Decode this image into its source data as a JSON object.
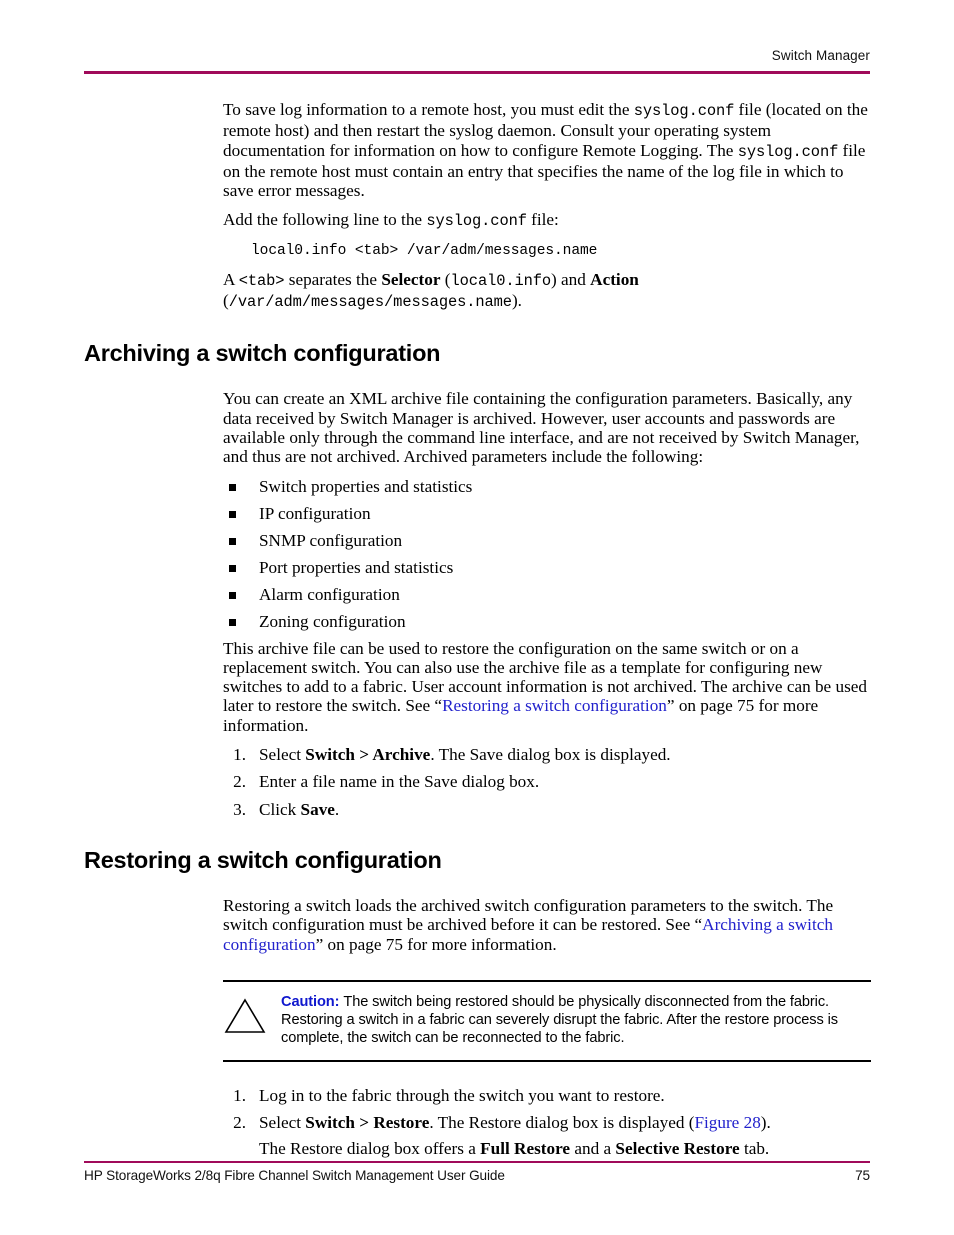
{
  "header": {
    "title": "Switch Manager",
    "rule_color": "#A00A5A"
  },
  "intro": {
    "para1_a": "To save log information to a remote host, you must edit the ",
    "para1_code1": "syslog.conf",
    "para1_b": " file (located on the remote host) and then restart the syslog daemon. Consult your operating system documentation for information on how to configure Remote Logging. The ",
    "para1_code2": "syslog.conf",
    "para1_c": " file on the remote host must contain an entry that specifies the name of the log file in which to save error messages.",
    "para2_a": "Add the following line to the ",
    "para2_code": "syslog.conf",
    "para2_b": " file:",
    "codeline": "local0.info <tab> /var/adm/messages.name",
    "para3_a": "A ",
    "para3_code1": "<tab>",
    "para3_b": " separates the ",
    "para3_bold1": "Selector",
    "para3_c": " (",
    "para3_code2": "local0.info",
    "para3_d": ") and ",
    "para3_bold2": "Action",
    "para3_e": " (",
    "para3_code3": "/var/adm/messages/messages.name",
    "para3_f": ")."
  },
  "archiving": {
    "heading": "Archiving a switch configuration",
    "para1": "You can create an XML archive file containing the configuration parameters. Basically, any data received by Switch Manager is archived. However, user accounts and passwords are available only through the command line interface, and are not received by Switch Manager, and thus are not archived. Archived parameters include the following:",
    "bullets": [
      "Switch properties and statistics",
      "IP configuration",
      "SNMP configuration",
      "Port properties and statistics",
      "Alarm configuration",
      "Zoning configuration"
    ],
    "para2_a": "This archive file can be used to restore the configuration on the same switch or on a replacement switch. You can also use the archive file as a template for configuring new switches to add to a fabric. User account information is not archived. The archive can be used later to restore the switch. See “",
    "para2_link": "Restoring a switch configuration",
    "para2_b": "” on page 75 for more information.",
    "steps": [
      {
        "number": "1.",
        "text_a": "Select ",
        "bold": "Switch > Archive",
        "text_b": ". The Save dialog box is displayed."
      },
      {
        "number": "2.",
        "text_a": "Enter a file name in the Save dialog box.",
        "bold": "",
        "text_b": ""
      },
      {
        "number": "3.",
        "text_a": "Click ",
        "bold": "Save",
        "text_b": "."
      }
    ]
  },
  "restoring": {
    "heading": "Restoring a switch configuration",
    "para1_a": "Restoring a switch loads the archived switch configuration parameters to the switch. The switch configuration must be archived before it can be restored. See “",
    "para1_link": "Archiving a switch configuration",
    "para1_b": "” on page 75 for more information.",
    "caution": {
      "icon": "warning-triangle-icon",
      "label": "Caution:",
      "text": "The switch being restored should be physically disconnected from the fabric. Restoring a switch in a fabric can severely disrupt the fabric. After the restore process is complete, the switch can be reconnected to the fabric.",
      "label_color": "#1018CE"
    },
    "steps": [
      {
        "number": "1.",
        "text_a": "Log in to the fabric through the switch you want to restore.",
        "bold": "",
        "text_b": "",
        "subline_a": "",
        "subline_bold1": "",
        "subline_b": "",
        "subline_bold2": "",
        "subline_c": ""
      },
      {
        "number": "2.",
        "text_a": "Select ",
        "bold": "Switch > Restore",
        "text_b": ". The Restore dialog box is displayed (",
        "link": "Figure 28",
        "text_c": ").",
        "subline_a": "The Restore dialog box offers a ",
        "subline_bold1": "Full Restore",
        "subline_b": " and a ",
        "subline_bold2": "Selective Restore",
        "subline_c": " tab."
      }
    ]
  },
  "footer": {
    "guide_title": "HP StorageWorks 2/8q Fibre Channel Switch Management User Guide",
    "page_number": "75",
    "rule_color": "#A00A5A"
  }
}
